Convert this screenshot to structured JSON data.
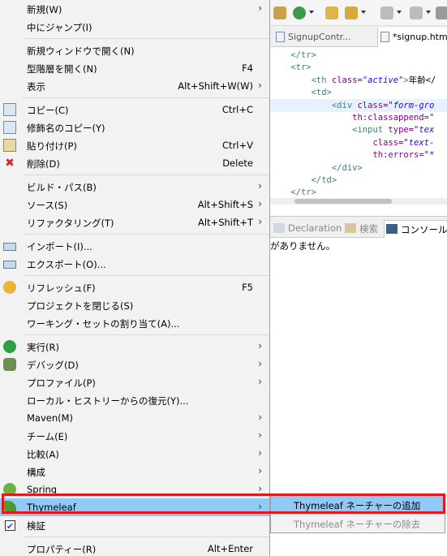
{
  "editor": {
    "tabs": [
      {
        "label": "SignupContr..."
      },
      {
        "label": "*signup.htm"
      }
    ],
    "code_lines": [
      {
        "indent": "    ",
        "parts": [
          {
            "c": "tag",
            "t": "</tr>"
          }
        ]
      },
      {
        "indent": "    ",
        "parts": [
          {
            "c": "tag",
            "t": "<tr>"
          }
        ]
      },
      {
        "indent": "        ",
        "parts": [
          {
            "c": "tag",
            "t": "<th "
          },
          {
            "c": "att",
            "t": "class="
          },
          {
            "c": "val",
            "t": "\"active\""
          },
          {
            "c": "tag",
            "t": ">"
          },
          {
            "c": "txt",
            "t": "年齢</"
          }
        ]
      },
      {
        "indent": "        ",
        "parts": [
          {
            "c": "tag",
            "t": "<td>"
          }
        ]
      },
      {
        "indent": "            ",
        "parts": [
          {
            "c": "tag",
            "t": "<div "
          },
          {
            "c": "att",
            "t": "class="
          },
          {
            "c": "val",
            "t": "\"form-gro"
          }
        ]
      },
      {
        "indent": "                ",
        "parts": [
          {
            "c": "att",
            "t": "th:classappend="
          },
          {
            "c": "val",
            "t": "\""
          }
        ]
      },
      {
        "indent": "                ",
        "parts": [
          {
            "c": "tag",
            "t": "<input "
          },
          {
            "c": "att",
            "t": "type="
          },
          {
            "c": "val",
            "t": "\"tex"
          }
        ]
      },
      {
        "indent": "                    ",
        "parts": [
          {
            "c": "att",
            "t": "class="
          },
          {
            "c": "val",
            "t": "\"text-"
          }
        ]
      },
      {
        "indent": "                    ",
        "parts": [
          {
            "c": "att",
            "t": "th:errors="
          },
          {
            "c": "val",
            "t": "\"*"
          }
        ]
      },
      {
        "indent": "            ",
        "parts": [
          {
            "c": "tag",
            "t": "</div>"
          }
        ]
      },
      {
        "indent": "        ",
        "parts": [
          {
            "c": "tag",
            "t": "</td>"
          }
        ]
      },
      {
        "indent": "    ",
        "parts": [
          {
            "c": "tag",
            "t": "</tr>"
          }
        ]
      }
    ],
    "panel_tabs": [
      {
        "label": "Declaration"
      },
      {
        "label": "検索"
      },
      {
        "label": "コンソール"
      }
    ],
    "console_message": "がありません。"
  },
  "menu": {
    "items": [
      {
        "label": "新規(W)",
        "shortcut": "",
        "submenu": true,
        "icon": ""
      },
      {
        "label": "中にジャンプ(I)",
        "shortcut": "",
        "submenu": false,
        "icon": ""
      },
      {
        "sep": true
      },
      {
        "label": "新規ウィンドウで開く(N)",
        "shortcut": "",
        "submenu": false,
        "icon": ""
      },
      {
        "label": "型階層を開く(N)",
        "shortcut": "F4",
        "submenu": false,
        "icon": ""
      },
      {
        "label": "表示",
        "shortcut": "Alt+Shift+W(W)",
        "submenu": true,
        "icon": ""
      },
      {
        "sep": true
      },
      {
        "label": "コピー(C)",
        "shortcut": "Ctrl+C",
        "submenu": false,
        "icon": "copy-icon"
      },
      {
        "label": "修飾名のコピー(Y)",
        "shortcut": "",
        "submenu": false,
        "icon": "copy-qualified-icon"
      },
      {
        "label": "貼り付け(P)",
        "shortcut": "Ctrl+V",
        "submenu": false,
        "icon": "paste-icon"
      },
      {
        "label": "削除(D)",
        "shortcut": "Delete",
        "submenu": false,
        "icon": "delete-icon"
      },
      {
        "sep": true
      },
      {
        "label": "ビルド・パス(B)",
        "shortcut": "",
        "submenu": true,
        "icon": ""
      },
      {
        "label": "ソース(S)",
        "shortcut": "Alt+Shift+S",
        "submenu": true,
        "icon": ""
      },
      {
        "label": "リファクタリング(T)",
        "shortcut": "Alt+Shift+T",
        "submenu": true,
        "icon": ""
      },
      {
        "sep": true
      },
      {
        "label": "インポート(I)...",
        "shortcut": "",
        "submenu": false,
        "icon": "import-icon"
      },
      {
        "label": "エクスポート(O)...",
        "shortcut": "",
        "submenu": false,
        "icon": "export-icon"
      },
      {
        "sep": true
      },
      {
        "label": "リフレッシュ(F)",
        "shortcut": "F5",
        "submenu": false,
        "icon": "refresh-icon"
      },
      {
        "label": "プロジェクトを閉じる(S)",
        "shortcut": "",
        "submenu": false,
        "icon": ""
      },
      {
        "label": "ワーキング・セットの割り当て(A)...",
        "shortcut": "",
        "submenu": false,
        "icon": ""
      },
      {
        "sep": true
      },
      {
        "label": "実行(R)",
        "shortcut": "",
        "submenu": true,
        "icon": "run-icon"
      },
      {
        "label": "デバッグ(D)",
        "shortcut": "",
        "submenu": true,
        "icon": "debug-icon"
      },
      {
        "label": "プロファイル(P)",
        "shortcut": "",
        "submenu": true,
        "icon": ""
      },
      {
        "label": "ローカル・ヒストリーからの復元(Y)...",
        "shortcut": "",
        "submenu": false,
        "icon": ""
      },
      {
        "label": "Maven(M)",
        "shortcut": "",
        "submenu": true,
        "icon": ""
      },
      {
        "label": "チーム(E)",
        "shortcut": "",
        "submenu": true,
        "icon": ""
      },
      {
        "label": "比較(A)",
        "shortcut": "",
        "submenu": true,
        "icon": ""
      },
      {
        "label": "構成",
        "shortcut": "",
        "submenu": true,
        "icon": ""
      },
      {
        "label": "Spring",
        "shortcut": "",
        "submenu": true,
        "icon": "spring-icon"
      },
      {
        "label": "Thymeleaf",
        "shortcut": "",
        "submenu": true,
        "icon": "thymeleaf-icon",
        "selected": true
      },
      {
        "label": "検証",
        "shortcut": "",
        "submenu": false,
        "icon": "validate-checkbox-icon"
      },
      {
        "sep": true
      },
      {
        "label": "プロパティー(R)",
        "shortcut": "Alt+Enter",
        "submenu": false,
        "icon": ""
      }
    ]
  },
  "submenu": {
    "items": [
      {
        "label": "Thymeleaf ネーチャーの追加",
        "selected": true,
        "disabled": false
      },
      {
        "label": "Thymeleaf ネーチャーの除去",
        "selected": false,
        "disabled": true
      }
    ]
  },
  "colors": {
    "menu_bg": "#f2f2f2",
    "selection": "#91c9f7",
    "highlight_box": "#e8151b"
  }
}
